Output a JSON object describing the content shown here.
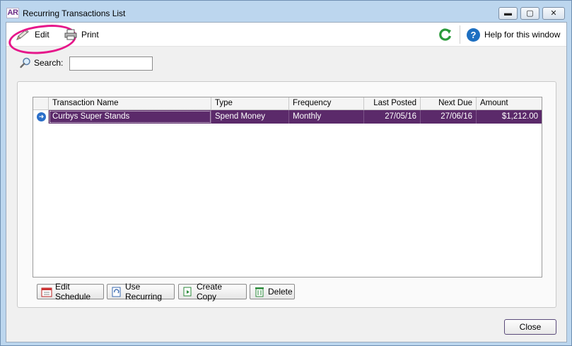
{
  "window": {
    "app_logo": "AR",
    "title": "Recurring Transactions List",
    "controls": {
      "minimize": "▬",
      "maximize": "▢",
      "close": "✕"
    }
  },
  "toolbar": {
    "edit_label": "Edit",
    "print_label": "Print",
    "help_label": "Help for this window",
    "help_glyph": "?"
  },
  "search": {
    "label": "Search:",
    "value": ""
  },
  "grid": {
    "columns": [
      "Transaction Name",
      "Type",
      "Frequency",
      "Last Posted",
      "Next Due",
      "Amount"
    ],
    "rows": [
      {
        "transaction_name": "Curbys Super Stands",
        "type": "Spend Money",
        "frequency": "Monthly",
        "last_posted": "27/05/16",
        "next_due": "27/06/16",
        "amount": "$1,212.00",
        "selected": true
      }
    ],
    "selected_row_color": "#5b2a6a"
  },
  "actions": {
    "edit_schedule": "Edit Schedule",
    "use_recurring": "Use Recurring",
    "create_copy": "Create Copy",
    "delete": "Delete"
  },
  "footer": {
    "close_label": "Close"
  },
  "colors": {
    "highlight_annotation": "#e6168a",
    "window_frame": "#bcd6ee",
    "refresh_green": "#2a9a3a",
    "help_blue": "#1d6fc1"
  }
}
